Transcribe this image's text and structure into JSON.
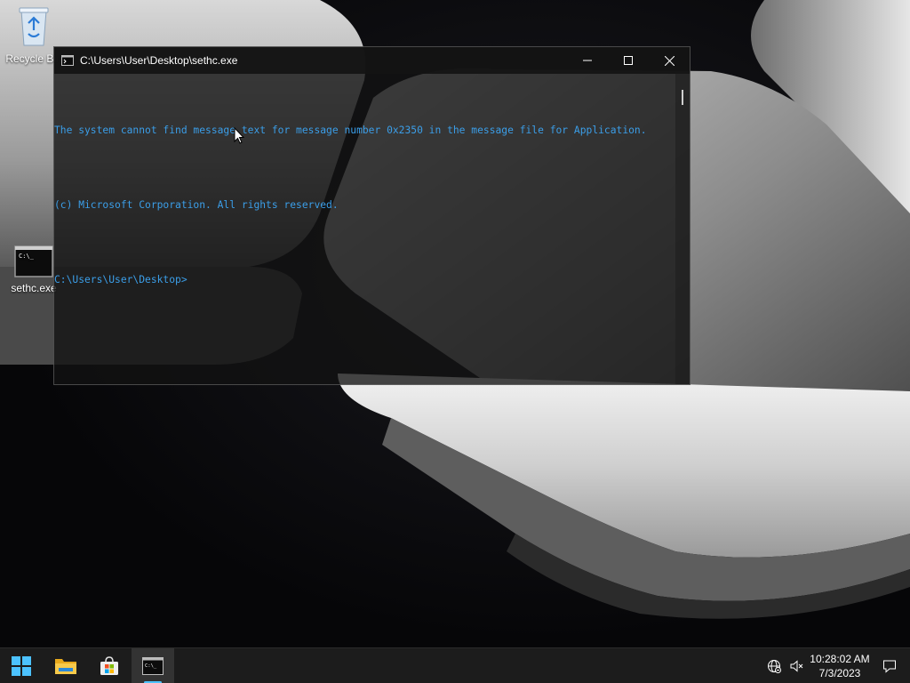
{
  "desktop": {
    "icons": [
      {
        "label": "Recycle Bin",
        "icon": "recycle-bin-icon"
      },
      {
        "label": "sethc.exe",
        "icon": "console-app-icon"
      }
    ]
  },
  "window": {
    "title": "C:\\Users\\User\\Desktop\\sethc.exe",
    "icon": "console-app-icon",
    "controls": {
      "minimize": "minimize-icon",
      "maximize": "maximize-icon",
      "close": "close-icon"
    },
    "console_lines": [
      "The system cannot find message text for message number 0x2350 in the message file for Application.",
      "(c) Microsoft Corporation. All rights reserved.",
      "C:\\Users\\User\\Desktop>"
    ],
    "text_color": "#3b9ee8"
  },
  "taskbar": {
    "apps": [
      {
        "name": "Start",
        "icon": "windows-start-icon"
      },
      {
        "name": "File Explorer",
        "icon": "folder-icon"
      },
      {
        "name": "Microsoft Store",
        "icon": "store-bag-icon"
      },
      {
        "name": "Command Prompt",
        "icon": "console-app-icon",
        "active": true
      }
    ],
    "tray": {
      "network_icon": "globe-network-icon",
      "volume_icon": "speaker-muted-icon",
      "time": "10:28:02 AM",
      "date": "7/3/2023",
      "notification_icon": "notification-icon"
    },
    "accent": "#4cc2ff"
  }
}
